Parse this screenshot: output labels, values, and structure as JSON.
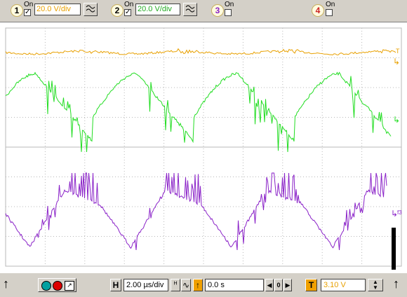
{
  "channels": [
    {
      "number": "1",
      "on_label": "On",
      "checked": true,
      "volts_per_div": "20.0 V/div",
      "coupling_icon": "ac-coupling-icon",
      "color": "#e8a000"
    },
    {
      "number": "2",
      "on_label": "On",
      "checked": true,
      "volts_per_div": "20.0 V/div",
      "coupling_icon": "ac-coupling-icon",
      "color": "#22dd22"
    },
    {
      "number": "3",
      "on_label": "On",
      "checked": false,
      "color": "#8a22c8"
    },
    {
      "number": "4",
      "on_label": "On",
      "checked": false,
      "color": "#cc2222"
    }
  ],
  "markers": {
    "ch1_trigger": "T",
    "ch2_marker": "↳",
    "ch3_marker": "f3"
  },
  "bottom_bar": {
    "horizontal_label": "H",
    "time_per_div": "2.00 µs/div",
    "position_value": "0.0 s",
    "trigger_label": "T",
    "trigger_level": "3.10 V",
    "run_indicator_color": "#dd0000"
  },
  "colors": {
    "background": "#d4d0c8",
    "screen_background": "#ffffff",
    "grid": "#b8b8b8",
    "channel1_trace": "#e8a000",
    "channel2_trace": "#22dd22",
    "channel3_trace": "#8a22c8"
  }
}
